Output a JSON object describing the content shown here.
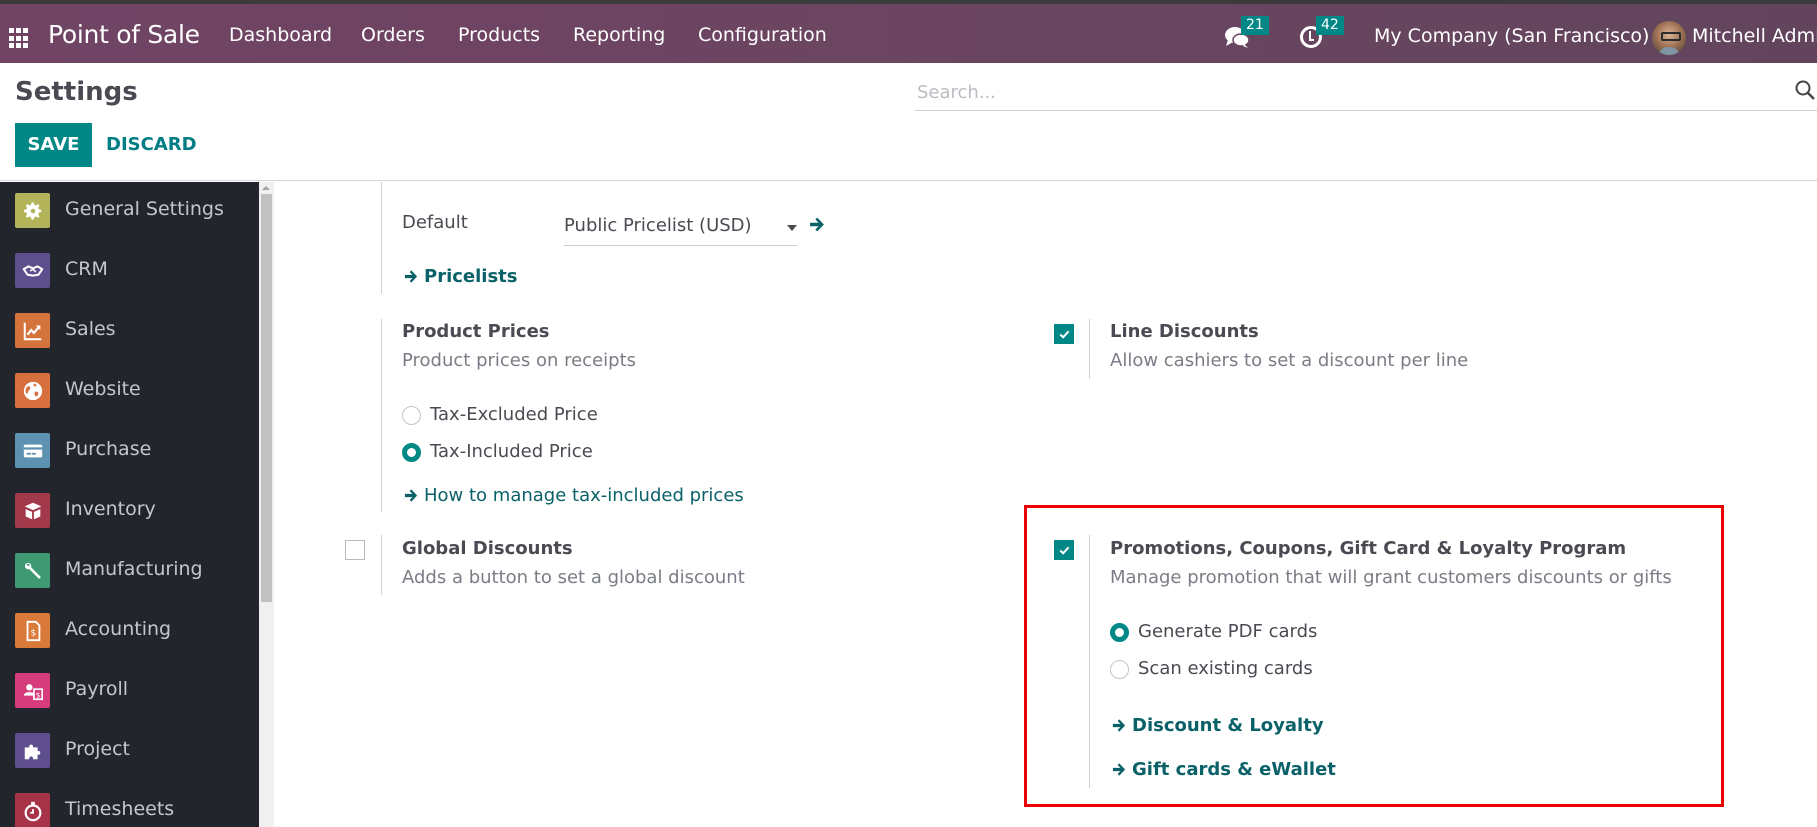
{
  "navbar": {
    "app_title": "Point of Sale",
    "menu": [
      "Dashboard",
      "Orders",
      "Products",
      "Reporting",
      "Configuration"
    ],
    "messages_count": "21",
    "activities_count": "42",
    "company": "My Company (San Francisco)",
    "user": "Mitchell Admin",
    "icons": {
      "apps": "apps-grid-icon",
      "messages": "chat-bubbles-icon",
      "activities": "clock-icon"
    },
    "background_color": "#714464"
  },
  "control_panel": {
    "title": "Settings",
    "save_label": "SAVE",
    "discard_label": "DISCARD",
    "search_placeholder": "Search...",
    "search_value": ""
  },
  "sidebar": {
    "items": [
      {
        "label": "General Settings",
        "icon": "gear-icon",
        "color": "#b3b35a"
      },
      {
        "label": "CRM",
        "icon": "handshake-icon",
        "color": "#5d4f8c"
      },
      {
        "label": "Sales",
        "icon": "trend-chart-icon",
        "color": "#d4733c"
      },
      {
        "label": "Website",
        "icon": "globe-icon",
        "color": "#d86f3e"
      },
      {
        "label": "Purchase",
        "icon": "credit-card-icon",
        "color": "#5d93b1"
      },
      {
        "label": "Inventory",
        "icon": "box-icon",
        "color": "#a2394b"
      },
      {
        "label": "Manufacturing",
        "icon": "wrench-icon",
        "color": "#3f9a74"
      },
      {
        "label": "Accounting",
        "icon": "invoice-icon",
        "color": "#d97a3a"
      },
      {
        "label": "Payroll",
        "icon": "employee-payslip-icon",
        "color": "#d63c7c"
      },
      {
        "label": "Project",
        "icon": "puzzle-icon",
        "color": "#5e4e8e"
      },
      {
        "label": "Timesheets",
        "icon": "stopwatch-icon",
        "color": "#a63347"
      }
    ]
  },
  "settings": {
    "pricelist": {
      "default_label": "Default",
      "default_value": "Public Pricelist (USD)",
      "link": "Pricelists"
    },
    "product_prices": {
      "title": "Product Prices",
      "description": "Product prices on receipts",
      "options": [
        {
          "label": "Tax-Excluded Price",
          "checked": false
        },
        {
          "label": "Tax-Included Price",
          "checked": true
        }
      ],
      "link": "How to manage tax-included prices"
    },
    "line_discounts": {
      "title": "Line Discounts",
      "description": "Allow cashiers to set a discount per line",
      "enabled": true
    },
    "global_discounts": {
      "title": "Global Discounts",
      "description": "Adds a button to set a global discount",
      "enabled": false
    },
    "promotions": {
      "title": "Promotions, Coupons, Gift Card & Loyalty Program",
      "description": "Manage promotion that will grant customers discounts or gifts",
      "enabled": true,
      "options": [
        {
          "label": "Generate PDF cards",
          "checked": true
        },
        {
          "label": "Scan existing cards",
          "checked": false
        }
      ],
      "links": [
        "Discount & Loyalty",
        "Gift cards & eWallet"
      ],
      "highlight_color": "#ee0000"
    }
  },
  "theme": {
    "primary": "#018886",
    "link": "#0a6168",
    "sidebar_bg": "#22252b"
  }
}
